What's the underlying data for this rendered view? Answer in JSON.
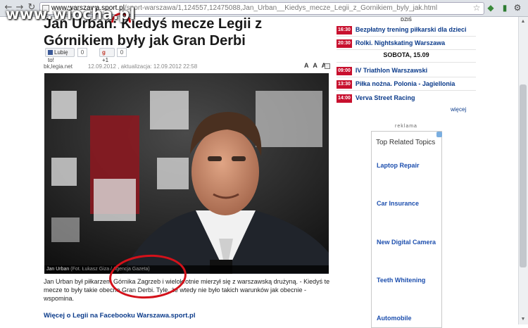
{
  "browser": {
    "url_host": "www.warszawa.sport.pl",
    "url_path": "/sport-warszawa/1,124557,12475088,Jan_Urban__Kiedys_mecze_Legii_z_Gornikiem_byly_jak.html",
    "back_glyph": "←",
    "forward_glyph": "→",
    "reload_glyph": "↻"
  },
  "watermark": "www.wiocha.pl",
  "article": {
    "headline": "Jan Urban: Kiedyś mecze Legii z Górnikiem były jak Gran Derbi",
    "like_label": "Lubię to!",
    "like_count": "0",
    "plus_label": "+1",
    "plus_count": "0",
    "author": "bk,legia.net",
    "date": "12.09.2012 , aktualizacja: 12.09.2012 22:58",
    "font_controls": "A A A",
    "caption_name": "Jan Urban",
    "caption_credit": "(Fot. Łukasz Giza / Agencja Gazeta)",
    "lead": "Jan Urban był piłkarzem Górnika Zagrzeb i wielokrotnie mierzył się z warszawską drużyną. - Kiedyś te mecze to były takie obecne Gran Derbi. Tyle, że wtedy nie było takich warunków jak obecnie - wspomina.",
    "facebook_link": "Więcej o Legii na Facebooku Warszawa.sport.pl"
  },
  "sidebar": {
    "today_label": "DZIŚ",
    "events_today": [
      {
        "time": "16:30",
        "title": "Bezpłatny trening piłkarski dla dzieci"
      },
      {
        "time": "20:30",
        "title": "Rolki. Nightskating Warszawa"
      }
    ],
    "day_label": "SOBOTA, 15.09",
    "events_saturday": [
      {
        "time": "09:00",
        "title": "IV Triathlon Warszawski"
      },
      {
        "time": "13:30",
        "title": "Piłka nożna. Polonia - Jagiellonia"
      },
      {
        "time": "14:00",
        "title": "Verva Street Racing"
      }
    ],
    "more_label": "więcej",
    "ad_label": "reklama",
    "ad_title": "Top Related Topics",
    "ad_links": [
      "Laptop Repair",
      "Car Insurance",
      "New Digital Camera",
      "Teeth Whitening",
      "Automobile"
    ]
  },
  "colors": {
    "accent": "#c8102e",
    "link": "#0a3a8a",
    "annotation": "#d4111a"
  }
}
